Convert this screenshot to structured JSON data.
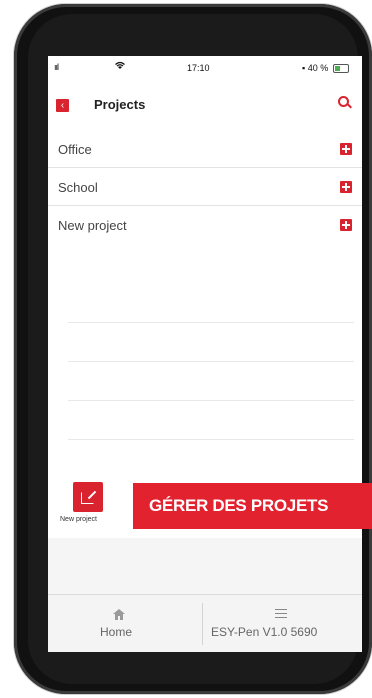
{
  "status_bar": {
    "signal": "ııl",
    "wifi_icon": "wifi-icon",
    "time": "17:10",
    "battery": "40 %"
  },
  "header": {
    "back_icon": "back-icon",
    "title": "Projects",
    "search_icon": "search-icon"
  },
  "projects": [
    {
      "name": "Office"
    },
    {
      "name": "School"
    },
    {
      "name": "New project"
    }
  ],
  "new_project": {
    "label": "New project"
  },
  "bottom_nav": {
    "home_label": "Home",
    "settings_label": "ESY-Pen V1.0 5690"
  },
  "promo": {
    "text": "GÉRER DES PROJETS"
  },
  "colors": {
    "accent": "#d9232e",
    "banner": "#e3222f"
  }
}
